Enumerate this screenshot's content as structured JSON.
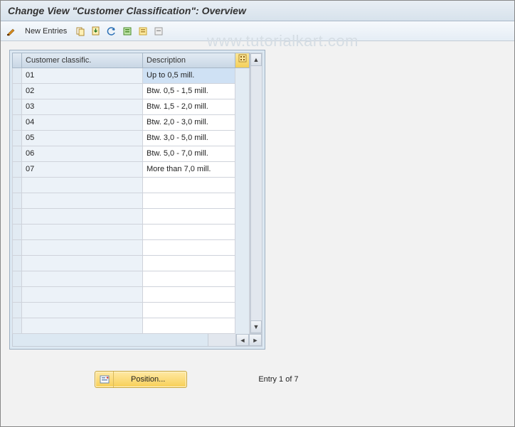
{
  "title": "Change View \"Customer Classification\": Overview",
  "watermark": "www.tutorialkart.com",
  "toolbar": {
    "new_entries": "New Entries",
    "icons": {
      "toggle": "pencil-toggle-icon",
      "copy": "copy-icon",
      "save": "save-down-icon",
      "undo": "undo-icon",
      "select_all": "select-all-icon",
      "select_block": "select-block-icon",
      "deselect": "deselect-icon"
    }
  },
  "columns": {
    "classific": "Customer classific.",
    "description": "Description"
  },
  "rows": [
    {
      "code": "01",
      "desc": "Up to 0,5 mill.",
      "desc_selected": true
    },
    {
      "code": "02",
      "desc": "Btw. 0,5 - 1,5 mill."
    },
    {
      "code": "03",
      "desc": "Btw. 1,5 - 2,0 mill."
    },
    {
      "code": "04",
      "desc": "Btw. 2,0 - 3,0 mill."
    },
    {
      "code": "05",
      "desc": "Btw. 3,0 - 5,0 mill."
    },
    {
      "code": "06",
      "desc": "Btw. 5,0 - 7,0 mill."
    },
    {
      "code": "07",
      "desc": "More than 7,0 mill."
    }
  ],
  "empty_rows": 10,
  "footer": {
    "position_label": "Position...",
    "entry_text": "Entry 1 of 7"
  }
}
